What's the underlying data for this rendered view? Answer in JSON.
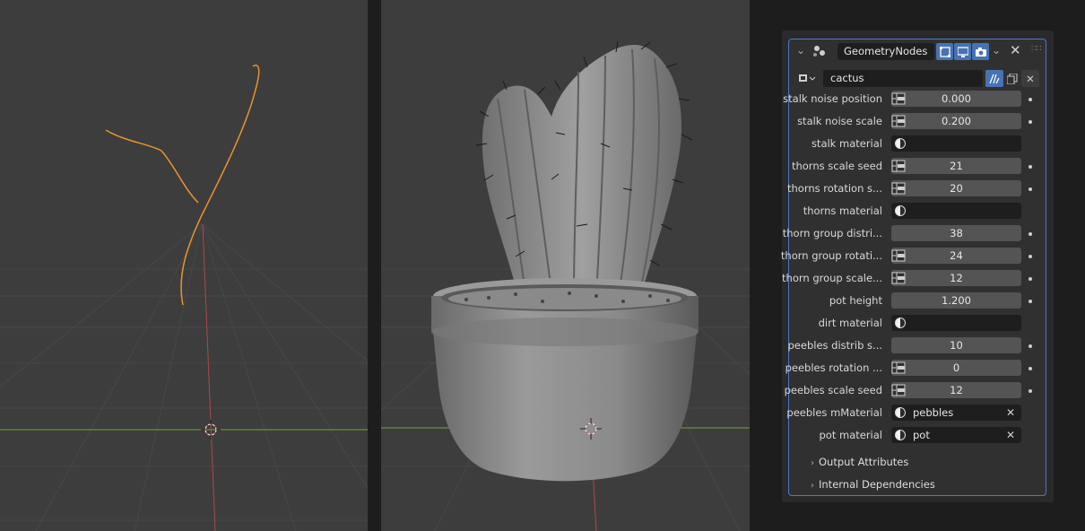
{
  "modifier": {
    "name": "GeometryNodes",
    "node_tree": "cactus",
    "icons": [
      "modifier-geometry-icon",
      "edit-mode-icon",
      "viewport-icon",
      "render-icon"
    ]
  },
  "inputs": [
    {
      "label": "stalk noise position",
      "value": "0.000",
      "attr_toggle": true,
      "keyframe": true,
      "kind": "number"
    },
    {
      "label": "stalk noise  scale",
      "value": "0.200",
      "attr_toggle": true,
      "keyframe": true,
      "kind": "number"
    },
    {
      "label": "stalk material",
      "value": "",
      "attr_toggle": false,
      "keyframe": false,
      "kind": "material"
    },
    {
      "label": "thorns scale seed",
      "value": "21",
      "attr_toggle": true,
      "keyframe": true,
      "kind": "number"
    },
    {
      "label": "thorns rotation s...",
      "value": "20",
      "attr_toggle": true,
      "keyframe": true,
      "kind": "number"
    },
    {
      "label": "thorns material",
      "value": "",
      "attr_toggle": false,
      "keyframe": false,
      "kind": "material"
    },
    {
      "label": "thorn group distri...",
      "value": "38",
      "attr_toggle": false,
      "keyframe": true,
      "kind": "number"
    },
    {
      "label": "thorn group rotati...",
      "value": "24",
      "attr_toggle": true,
      "keyframe": true,
      "kind": "number"
    },
    {
      "label": "thorn group scale...",
      "value": "12",
      "attr_toggle": true,
      "keyframe": true,
      "kind": "number"
    },
    {
      "label": "pot height",
      "value": "1.200",
      "attr_toggle": false,
      "keyframe": true,
      "kind": "number"
    },
    {
      "label": "dirt material",
      "value": "",
      "attr_toggle": false,
      "keyframe": false,
      "kind": "material"
    },
    {
      "label": "peebles distrib s...",
      "value": "10",
      "attr_toggle": false,
      "keyframe": true,
      "kind": "number"
    },
    {
      "label": "peebles rotation ...",
      "value": "0",
      "attr_toggle": true,
      "keyframe": true,
      "kind": "number"
    },
    {
      "label": "peebles scale seed",
      "value": "12",
      "attr_toggle": true,
      "keyframe": true,
      "kind": "number"
    },
    {
      "label": "peebles mMaterial",
      "value": "pebbles",
      "attr_toggle": false,
      "keyframe": false,
      "kind": "material"
    },
    {
      "label": "pot material",
      "value": "pot",
      "attr_toggle": false,
      "keyframe": false,
      "kind": "material"
    }
  ],
  "subpanels": [
    "Output Attributes",
    "Internal Dependencies"
  ],
  "colors": {
    "accent": "#4772b3",
    "curve": "#e8962a",
    "viewport": "#3d3d3d"
  }
}
